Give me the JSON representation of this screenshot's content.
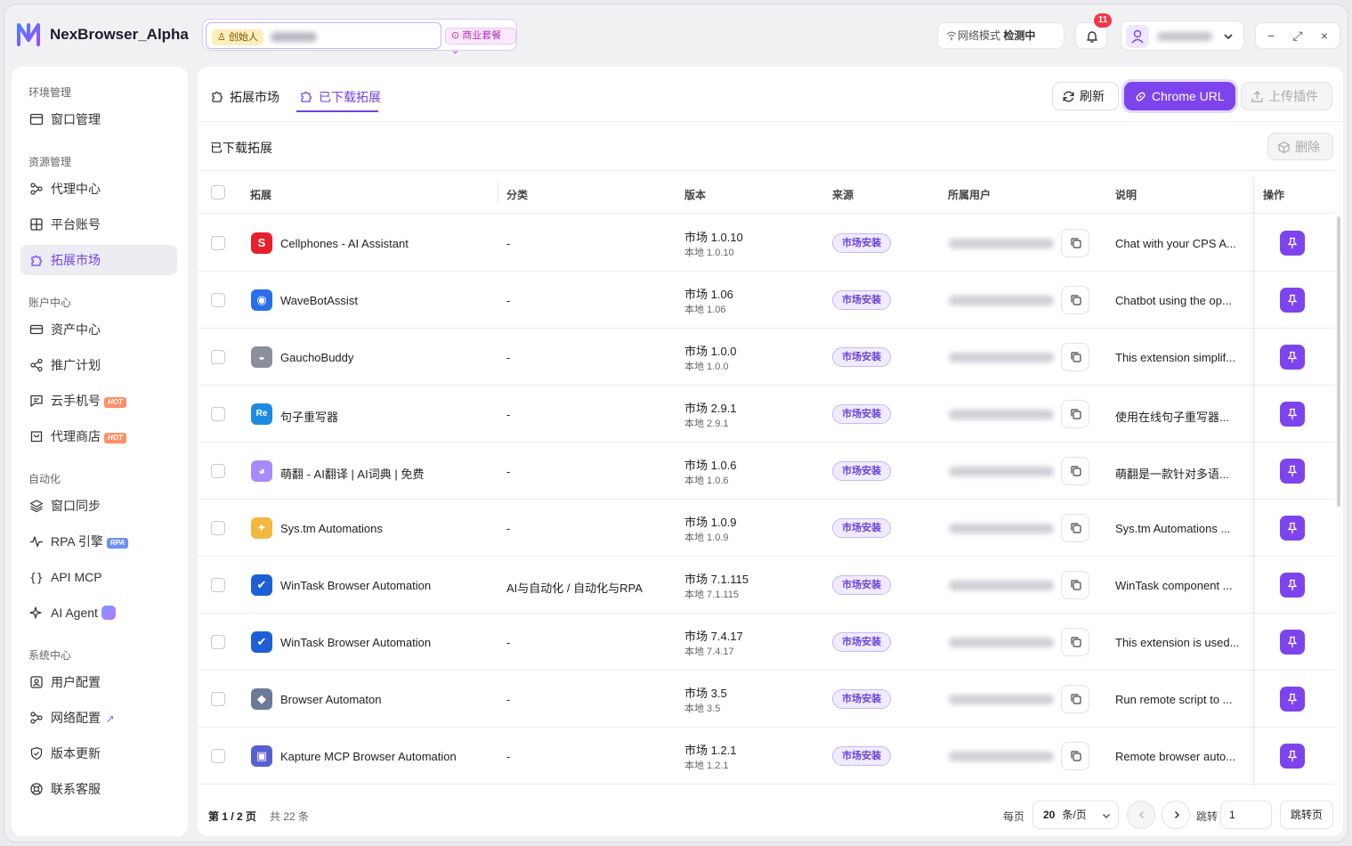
{
  "app": {
    "name": "NexBrowser_Alpha"
  },
  "header": {
    "creator_tag": "创始人",
    "plan_tag": "商业套餐",
    "network_label": "网络模式",
    "network_status": "检测中",
    "notification_count": "11",
    "window_controls": [
      "−",
      "⤢",
      "×"
    ]
  },
  "sidebar": {
    "sections": [
      {
        "title": "环境管理",
        "items": [
          {
            "label": "窗口管理",
            "icon": "window-icon"
          }
        ]
      },
      {
        "title": "资源管理",
        "items": [
          {
            "label": "代理中心",
            "icon": "proxy-icon"
          },
          {
            "label": "平台账号",
            "icon": "grid-icon"
          },
          {
            "label": "拓展市场",
            "icon": "puzzle-icon",
            "active": true
          }
        ]
      },
      {
        "title": "账户中心",
        "items": [
          {
            "label": "资产中心",
            "icon": "wallet-icon"
          },
          {
            "label": "推广计划",
            "icon": "share-icon"
          },
          {
            "label": "云手机号",
            "icon": "message-icon",
            "tag": "HOT"
          },
          {
            "label": "代理商店",
            "icon": "shop-icon",
            "tag": "HOT"
          }
        ]
      },
      {
        "title": "自动化",
        "items": [
          {
            "label": "窗口同步",
            "icon": "layers-icon"
          },
          {
            "label": "RPA 引擎",
            "icon": "pulse-icon",
            "tag": "RPA"
          },
          {
            "label": "API MCP",
            "icon": "braces-icon"
          },
          {
            "label": "AI Agent",
            "icon": "sparkle-icon"
          }
        ]
      },
      {
        "title": "系统中心",
        "items": [
          {
            "label": "用户配置",
            "icon": "user-config-icon"
          },
          {
            "label": "网络配置",
            "icon": "network-icon"
          },
          {
            "label": "版本更新",
            "icon": "shield-icon"
          },
          {
            "label": "联系客服",
            "icon": "support-icon"
          }
        ]
      }
    ],
    "hot_tag": "HOT",
    "rpa_tag": "RPA"
  },
  "main": {
    "tabs": [
      {
        "label": "拓展市场"
      },
      {
        "label": "已下载拓展",
        "active": true
      }
    ],
    "refresh_label": "刷新",
    "chrome_url_label": "Chrome URL",
    "upload_label": "上传插件",
    "subheading": "已下载拓展",
    "delete_label": "删除",
    "columns": [
      "拓展",
      "分类",
      "版本",
      "来源",
      "所属用户",
      "说明",
      "操作"
    ],
    "rows": [
      {
        "name": "Cellphones - AI Assistant",
        "category": "-",
        "ver_market": "市场 1.0.10",
        "ver_local": "本地 1.0.10",
        "source": "市场安装",
        "desc": "Chat with your CPS A...",
        "icon_color": "#e8202c",
        "icon_char": "S"
      },
      {
        "name": "WaveBotAssist",
        "category": "-",
        "ver_market": "市场 1.06",
        "ver_local": "本地 1.06",
        "source": "市场安装",
        "desc": "Chatbot using the op...",
        "icon_color": "#2a6ee8",
        "icon_char": "◉"
      },
      {
        "name": "GauchoBuddy",
        "category": "-",
        "ver_market": "市场 1.0.0",
        "ver_local": "本地 1.0.0",
        "source": "市场安装",
        "desc": "This extension simplif...",
        "icon_color": "#8a8f9c",
        "icon_char": "◒"
      },
      {
        "name": "句子重写器",
        "category": "-",
        "ver_market": "市场 2.9.1",
        "ver_local": "本地 2.9.1",
        "source": "市场安装",
        "desc": "使用在线句子重写器...",
        "icon_color": "#1d8ce0",
        "icon_char": "Re"
      },
      {
        "name": "萌翻 - AI翻译 | AI词典 | 免费",
        "category": "-",
        "ver_market": "市场 1.0.6",
        "ver_local": "本地 1.0.6",
        "source": "市场安装",
        "desc": "萌翻是一款针对多语...",
        "icon_color": "#a78bfa",
        "icon_char": "◕"
      },
      {
        "name": "Sys.tm Automations",
        "category": "-",
        "ver_market": "市场 1.0.9",
        "ver_local": "本地 1.0.9",
        "source": "市场安装",
        "desc": "Sys.tm Automations ...",
        "icon_color": "#f4b740",
        "icon_char": "✦"
      },
      {
        "name": "WinTask Browser Automation",
        "category": "AI与自动化 / 自动化与RPA",
        "ver_market": "市场 7.1.115",
        "ver_local": "本地 7.1.115",
        "source": "市场安装",
        "desc": "WinTask component ...",
        "icon_color": "#1e5fd6",
        "icon_char": "✔"
      },
      {
        "name": "WinTask Browser Automation",
        "category": "-",
        "ver_market": "市场 7.4.17",
        "ver_local": "本地 7.4.17",
        "source": "市场安装",
        "desc": "This extension is used...",
        "icon_color": "#1e5fd6",
        "icon_char": "✔"
      },
      {
        "name": "Browser Automaton",
        "category": "-",
        "ver_market": "市场 3.5",
        "ver_local": "本地 3.5",
        "source": "市场安装",
        "desc": "Run remote script to ...",
        "icon_color": "#6b7a99",
        "icon_char": "◆"
      },
      {
        "name": "Kapture MCP Browser Automation",
        "category": "-",
        "ver_market": "市场 1.2.1",
        "ver_local": "本地 1.2.1",
        "source": "市场安装",
        "desc": "Remote browser auto...",
        "icon_color": "#5a5fd0",
        "icon_char": "▣"
      }
    ]
  },
  "pagination": {
    "page_label": "第 1 / 2 页",
    "total_label": "共 22 条",
    "per_page_label": "每页",
    "per_page_value": "20",
    "per_page_unit": "条/页",
    "jump_label": "跳转",
    "jump_value": "1",
    "jump_button": "跳转页"
  },
  "colors": {
    "accent": "#7d44ee",
    "accent_light": "#f0ebff",
    "badge": "#f2374a"
  }
}
